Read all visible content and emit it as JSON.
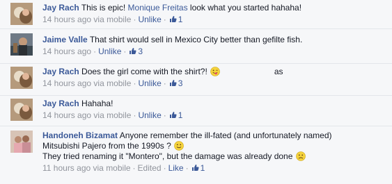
{
  "comments": [
    {
      "author": "Jay Rach",
      "text": "This is epic!",
      "mention": "Monique Freitas",
      "text_after": "look what you started hahaha!",
      "time": "14 hours ago",
      "via": "via mobile",
      "action": "Unlike",
      "likes": "1"
    },
    {
      "author": "Jaime Valle",
      "text": "That shirt would sell in Mexico City better than gefilte fish.",
      "time": "14 hours ago",
      "action": "Unlike",
      "likes": "3"
    },
    {
      "author": "Jay Rach",
      "text": "Does the girl come with the shirt?!",
      "text_after": "as",
      "time": "14 hours ago",
      "via": "via mobile",
      "action": "Unlike",
      "likes": "3"
    },
    {
      "author": "Jay Rach",
      "text": "Hahaha!",
      "time": "14 hours ago",
      "via": "via mobile",
      "action": "Unlike",
      "likes": "1"
    },
    {
      "author": "Handoneh Bizamat",
      "text": "Anyone remember the ill-fated (and unfortunately named)",
      "text_line2": "Mitsubishi Pajero from the 1990s ?",
      "text_line3": "They tried renaming it \"Montero\", but the damage was already done",
      "time": "11 hours ago",
      "via": "via mobile",
      "edited": "Edited",
      "action": "Like",
      "likes": "1"
    }
  ],
  "icons": {
    "like": "thumbs-up-icon",
    "emoji_tongue": "tongue-emoji",
    "emoji_smile": "smile-emoji",
    "emoji_frown": "frown-emoji"
  },
  "colors": {
    "link": "#3b5998",
    "meta": "#90949c",
    "background": "#f6f7f9"
  }
}
